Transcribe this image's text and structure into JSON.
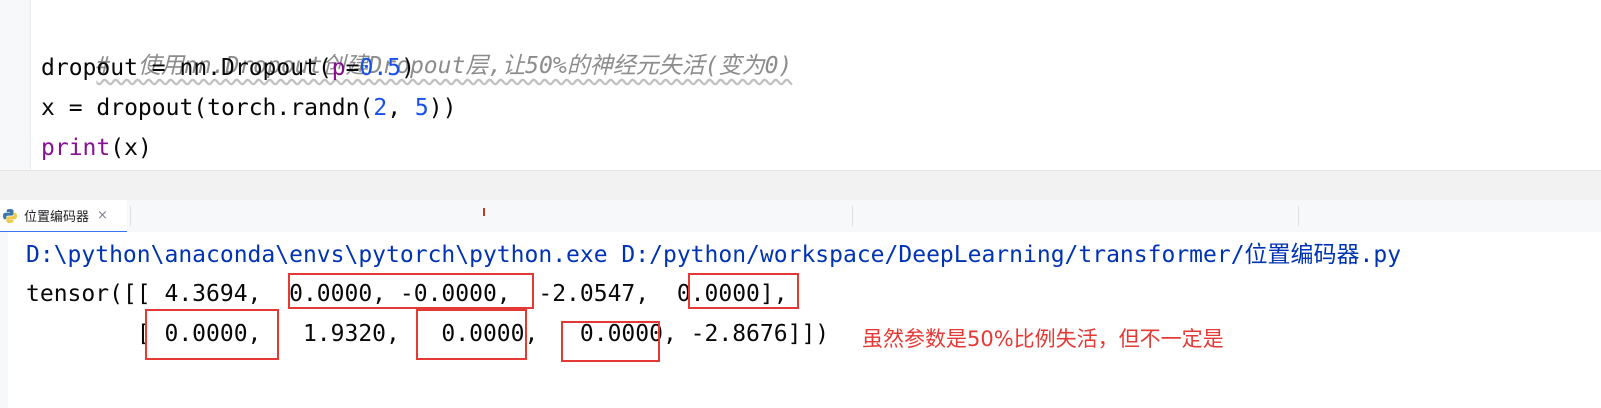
{
  "editor": {
    "lines": [
      {
        "comment": "#  使用nn.Dropout创建Dropout层,让50%的神经元失活(变为0)"
      },
      {
        "before": "dropout = nn.Dropout(",
        "param": "p",
        "eq": "=",
        "num": "0.5",
        "after": ")"
      },
      {
        "before": "x = dropout(torch.randn(",
        "num1": "2",
        "comma": ", ",
        "num2": "5",
        "after": "))"
      },
      {
        "fn": "print",
        "after": "(x)"
      }
    ]
  },
  "tool_window": {
    "run_tab_label": "位置编码器",
    "close_glyph": "×"
  },
  "console": {
    "command": "D:\\python\\anaconda\\envs\\pytorch\\python.exe D:/python/workspace/DeepLearning/transformer/位置编码器.py",
    "output_line_1": "tensor([[ 4.3694,  0.0000, -0.0000,  -2.0547,  0.0000],",
    "output_line_2": "        [ 0.0000,   1.9320,   0.0000,   0.0000, -2.8676]])"
  },
  "annotation": {
    "text": "虽然参数是50%比例失活，但不一定是",
    "color": "#e53935"
  },
  "colors": {
    "comment": "#8c8c8c",
    "number": "#1750eb",
    "keyword": "#871094",
    "command_path": "#0033b3",
    "highlight_border": "#e53935"
  },
  "icons": {
    "run_tab": "python-icon"
  }
}
